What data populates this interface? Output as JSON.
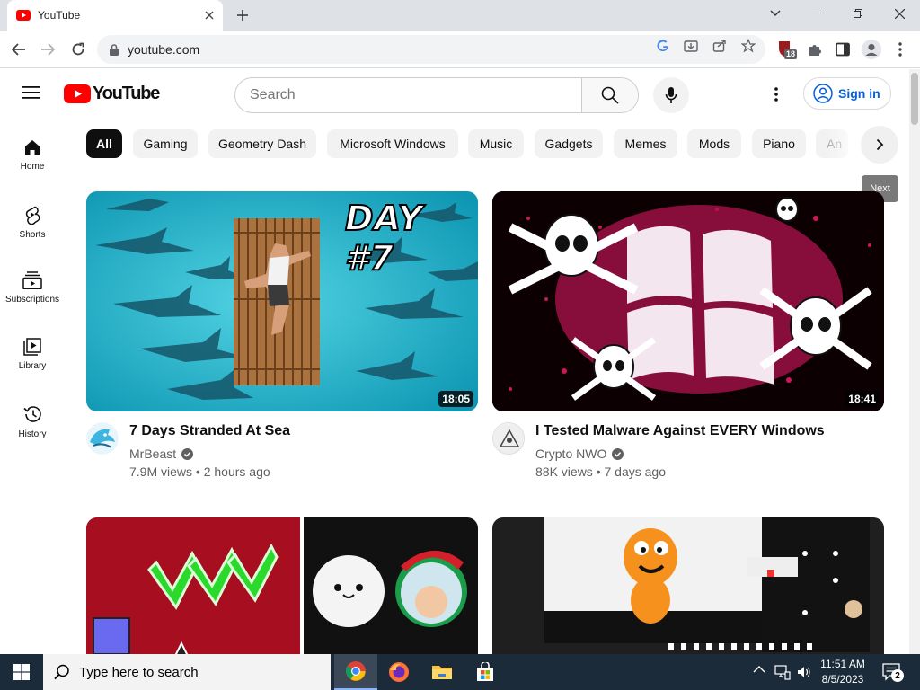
{
  "browser": {
    "tab_title": "YouTube",
    "url": "youtube.com",
    "extension_badge": "18"
  },
  "youtube": {
    "logo_text": "YouTube",
    "search_placeholder": "Search",
    "sign_in_label": "Sign in",
    "next_tooltip": "Next",
    "nav": [
      {
        "label": "Home"
      },
      {
        "label": "Shorts"
      },
      {
        "label": "Subscriptions"
      },
      {
        "label": "Library"
      },
      {
        "label": "History"
      }
    ],
    "chips": [
      "All",
      "Gaming",
      "Geometry Dash",
      "Microsoft Windows",
      "Music",
      "Gadgets",
      "Memes",
      "Mods",
      "Piano",
      "An"
    ],
    "videos": [
      {
        "title": "7 Days Stranded At Sea",
        "thumbnail_text": "DAY #7",
        "channel": "MrBeast",
        "verified": true,
        "views": "7.9M views",
        "age": "2 hours ago",
        "duration": "18:05"
      },
      {
        "title": "I Tested Malware Against EVERY Windows",
        "channel": "Crypto NWO",
        "verified": true,
        "views": "88K views",
        "age": "7 days ago",
        "duration": "18:41"
      }
    ]
  },
  "taskbar": {
    "search_placeholder": "Type here to search",
    "time": "11:51 AM",
    "date": "8/5/2023",
    "notification_count": "2"
  },
  "colors": {
    "youtube_red": "#ff0000",
    "link_blue": "#065fd4",
    "taskbar_bg": "#1c2b39",
    "chip_bg": "#f2f2f2"
  }
}
